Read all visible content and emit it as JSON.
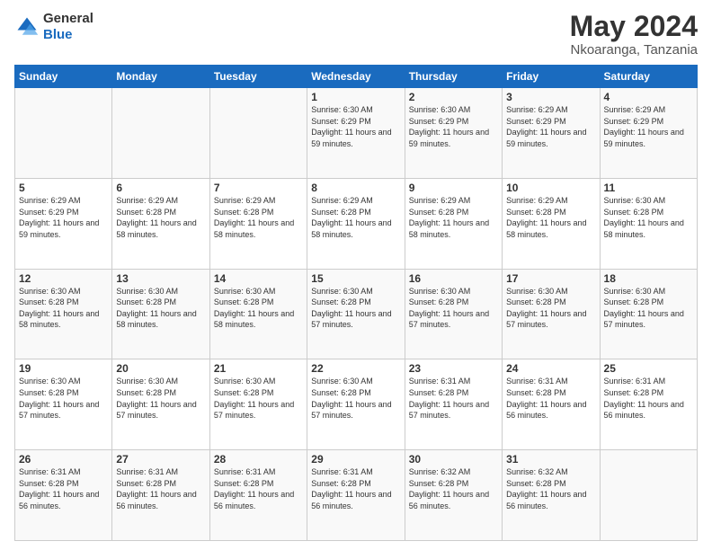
{
  "header": {
    "logo_general": "General",
    "logo_blue": "Blue",
    "month_title": "May 2024",
    "location": "Nkoaranga, Tanzania"
  },
  "days_of_week": [
    "Sunday",
    "Monday",
    "Tuesday",
    "Wednesday",
    "Thursday",
    "Friday",
    "Saturday"
  ],
  "weeks": [
    [
      {
        "day": "",
        "info": ""
      },
      {
        "day": "",
        "info": ""
      },
      {
        "day": "",
        "info": ""
      },
      {
        "day": "1",
        "info": "Sunrise: 6:30 AM\nSunset: 6:29 PM\nDaylight: 11 hours and 59 minutes."
      },
      {
        "day": "2",
        "info": "Sunrise: 6:30 AM\nSunset: 6:29 PM\nDaylight: 11 hours and 59 minutes."
      },
      {
        "day": "3",
        "info": "Sunrise: 6:29 AM\nSunset: 6:29 PM\nDaylight: 11 hours and 59 minutes."
      },
      {
        "day": "4",
        "info": "Sunrise: 6:29 AM\nSunset: 6:29 PM\nDaylight: 11 hours and 59 minutes."
      }
    ],
    [
      {
        "day": "5",
        "info": "Sunrise: 6:29 AM\nSunset: 6:29 PM\nDaylight: 11 hours and 59 minutes."
      },
      {
        "day": "6",
        "info": "Sunrise: 6:29 AM\nSunset: 6:28 PM\nDaylight: 11 hours and 58 minutes."
      },
      {
        "day": "7",
        "info": "Sunrise: 6:29 AM\nSunset: 6:28 PM\nDaylight: 11 hours and 58 minutes."
      },
      {
        "day": "8",
        "info": "Sunrise: 6:29 AM\nSunset: 6:28 PM\nDaylight: 11 hours and 58 minutes."
      },
      {
        "day": "9",
        "info": "Sunrise: 6:29 AM\nSunset: 6:28 PM\nDaylight: 11 hours and 58 minutes."
      },
      {
        "day": "10",
        "info": "Sunrise: 6:29 AM\nSunset: 6:28 PM\nDaylight: 11 hours and 58 minutes."
      },
      {
        "day": "11",
        "info": "Sunrise: 6:30 AM\nSunset: 6:28 PM\nDaylight: 11 hours and 58 minutes."
      }
    ],
    [
      {
        "day": "12",
        "info": "Sunrise: 6:30 AM\nSunset: 6:28 PM\nDaylight: 11 hours and 58 minutes."
      },
      {
        "day": "13",
        "info": "Sunrise: 6:30 AM\nSunset: 6:28 PM\nDaylight: 11 hours and 58 minutes."
      },
      {
        "day": "14",
        "info": "Sunrise: 6:30 AM\nSunset: 6:28 PM\nDaylight: 11 hours and 58 minutes."
      },
      {
        "day": "15",
        "info": "Sunrise: 6:30 AM\nSunset: 6:28 PM\nDaylight: 11 hours and 57 minutes."
      },
      {
        "day": "16",
        "info": "Sunrise: 6:30 AM\nSunset: 6:28 PM\nDaylight: 11 hours and 57 minutes."
      },
      {
        "day": "17",
        "info": "Sunrise: 6:30 AM\nSunset: 6:28 PM\nDaylight: 11 hours and 57 minutes."
      },
      {
        "day": "18",
        "info": "Sunrise: 6:30 AM\nSunset: 6:28 PM\nDaylight: 11 hours and 57 minutes."
      }
    ],
    [
      {
        "day": "19",
        "info": "Sunrise: 6:30 AM\nSunset: 6:28 PM\nDaylight: 11 hours and 57 minutes."
      },
      {
        "day": "20",
        "info": "Sunrise: 6:30 AM\nSunset: 6:28 PM\nDaylight: 11 hours and 57 minutes."
      },
      {
        "day": "21",
        "info": "Sunrise: 6:30 AM\nSunset: 6:28 PM\nDaylight: 11 hours and 57 minutes."
      },
      {
        "day": "22",
        "info": "Sunrise: 6:30 AM\nSunset: 6:28 PM\nDaylight: 11 hours and 57 minutes."
      },
      {
        "day": "23",
        "info": "Sunrise: 6:31 AM\nSunset: 6:28 PM\nDaylight: 11 hours and 57 minutes."
      },
      {
        "day": "24",
        "info": "Sunrise: 6:31 AM\nSunset: 6:28 PM\nDaylight: 11 hours and 56 minutes."
      },
      {
        "day": "25",
        "info": "Sunrise: 6:31 AM\nSunset: 6:28 PM\nDaylight: 11 hours and 56 minutes."
      }
    ],
    [
      {
        "day": "26",
        "info": "Sunrise: 6:31 AM\nSunset: 6:28 PM\nDaylight: 11 hours and 56 minutes."
      },
      {
        "day": "27",
        "info": "Sunrise: 6:31 AM\nSunset: 6:28 PM\nDaylight: 11 hours and 56 minutes."
      },
      {
        "day": "28",
        "info": "Sunrise: 6:31 AM\nSunset: 6:28 PM\nDaylight: 11 hours and 56 minutes."
      },
      {
        "day": "29",
        "info": "Sunrise: 6:31 AM\nSunset: 6:28 PM\nDaylight: 11 hours and 56 minutes."
      },
      {
        "day": "30",
        "info": "Sunrise: 6:32 AM\nSunset: 6:28 PM\nDaylight: 11 hours and 56 minutes."
      },
      {
        "day": "31",
        "info": "Sunrise: 6:32 AM\nSunset: 6:28 PM\nDaylight: 11 hours and 56 minutes."
      },
      {
        "day": "",
        "info": ""
      }
    ]
  ]
}
